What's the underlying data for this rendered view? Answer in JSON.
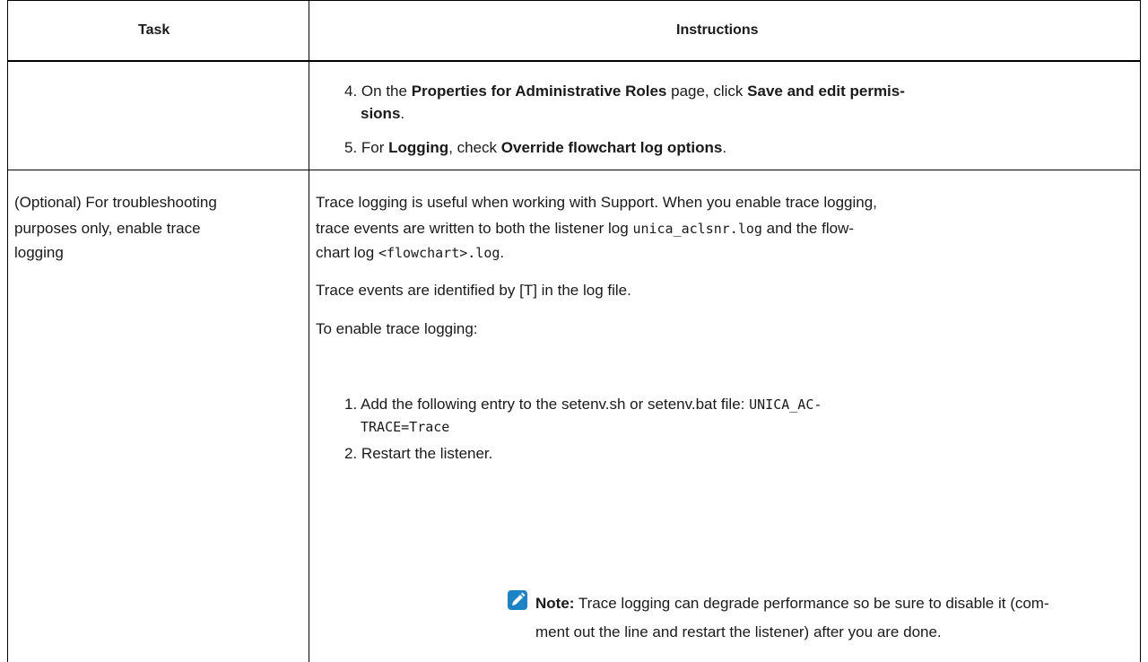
{
  "table": {
    "headers": {
      "task": "Task",
      "instructions": "Instructions"
    },
    "row1": {
      "step4": {
        "num": "4.",
        "pre": "On the",
        "b1": "Properties for Administrative Roles",
        "mid": "page, click",
        "b2a": "Save and edit permis-",
        "b2b": "sions",
        "end": "."
      },
      "step5": {
        "num": "5.",
        "pre": "For",
        "b1": "Logging",
        "mid": ", check",
        "b2": "Override flowchart log options",
        "end": "."
      }
    },
    "row2": {
      "task_lines": [
        "(Optional) For troubleshooting",
        "purposes only, enable trace",
        "logging"
      ],
      "p1": {
        "l1": "Trace logging is useful when working with Support. When you enable trace logging,",
        "l2_pre": "trace events are written to both the listener log",
        "l2_code": "unica_aclsnr.log",
        "l2_post": "and the flow-",
        "l3_pre": "chart log",
        "l3_code": "<flowchart>.log",
        "l3_post": "."
      },
      "p2": "Trace events are identified by [T] in the log file.",
      "p3": "To enable trace logging:",
      "step1": {
        "num": "1.",
        "text": "Add the following entry to the setenv.sh or setenv.bat file:",
        "code1": "UNICA_AC-",
        "code2": "TRACE=Trace"
      },
      "step2": {
        "num": "2.",
        "text": "Restart the listener."
      },
      "note": {
        "label": "Note:",
        "l1": "Trace logging can degrade performance so be sure to disable it (com-",
        "l2": "ment out the line and restart the listener) after you are done."
      }
    }
  },
  "colors": {
    "note_icon": "#1a84c7",
    "border": "#000000",
    "text": "#1a1a1a"
  }
}
